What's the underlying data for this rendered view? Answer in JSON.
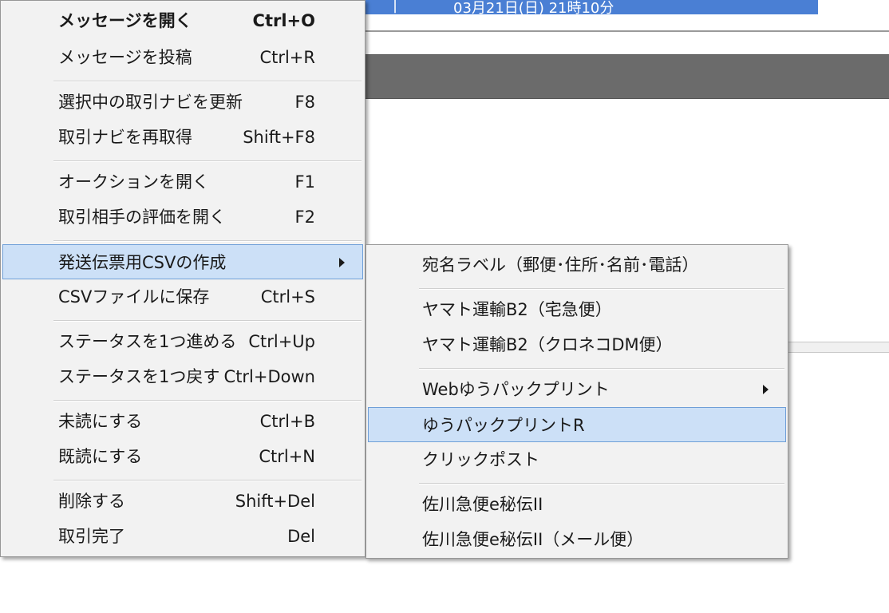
{
  "background": {
    "header_mark": "|",
    "header_date": "03月21日(日) 21時10分"
  },
  "context_menu": {
    "items": [
      {
        "label": "メッセージを開く",
        "shortcut": "Ctrl+O"
      },
      {
        "label": "メッセージを投稿",
        "shortcut": "Ctrl+R"
      },
      {
        "label": "選択中の取引ナビを更新",
        "shortcut": "F8"
      },
      {
        "label": "取引ナビを再取得",
        "shortcut": "Shift+F8"
      },
      {
        "label": "オークションを開く",
        "shortcut": "F1"
      },
      {
        "label": "取引相手の評価を開く",
        "shortcut": "F2"
      },
      {
        "label": "発送伝票用CSVの作成",
        "shortcut": ""
      },
      {
        "label": "CSVファイルに保存",
        "shortcut": "Ctrl+S"
      },
      {
        "label": "ステータスを1つ進める",
        "shortcut": "Ctrl+Up"
      },
      {
        "label": "ステータスを1つ戻す",
        "shortcut": "Ctrl+Down"
      },
      {
        "label": "未読にする",
        "shortcut": "Ctrl+B"
      },
      {
        "label": "既読にする",
        "shortcut": "Ctrl+N"
      },
      {
        "label": "削除する",
        "shortcut": "Shift+Del"
      },
      {
        "label": "取引完了",
        "shortcut": "Del"
      }
    ]
  },
  "submenu": {
    "items": [
      {
        "label": "宛名ラベル（郵便･住所･名前･電話）"
      },
      {
        "label": "ヤマト運輸B2（宅急便）"
      },
      {
        "label": "ヤマト運輸B2（クロネコDM便）"
      },
      {
        "label": "Webゆうパックプリント"
      },
      {
        "label": "ゆうパックプリントR"
      },
      {
        "label": "クリックポスト"
      },
      {
        "label": "佐川急便e秘伝II"
      },
      {
        "label": "佐川急便e秘伝II（メール便）"
      }
    ]
  },
  "colors": {
    "highlight": "#cce0f7",
    "highlight_border": "#6f9fd8",
    "menu_bg": "#f2f2f2",
    "header_blue": "#4a7fd4"
  }
}
